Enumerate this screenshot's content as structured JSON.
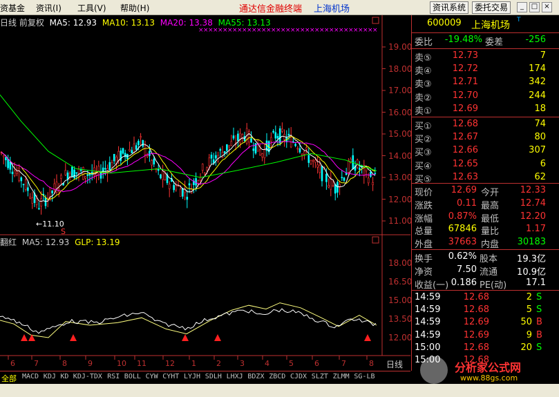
{
  "menu": {
    "item0": "资基金",
    "item1": "资讯(I)",
    "item2": "工具(V)",
    "item3": "帮助(H)",
    "title": "通达信金融终端",
    "subtitle": "上海机场",
    "btn_info": "资讯系统",
    "btn_trade": "委托交易"
  },
  "chart": {
    "main_indicator": "日线 前复权",
    "ma5": "MA5: 12.93",
    "ma10": "MA10: 13.13",
    "ma20": "MA20: 13.38",
    "ma55": "MA55: 13.13",
    "low_mark": "←11.10",
    "sub_indicator": "翻红",
    "sub_ma5": "MA5: 12.93",
    "sub_glp": "GLP: 13.19",
    "period": "日线",
    "x_ticks": [
      "6",
      "7",
      "8",
      "9",
      "10",
      "11",
      "12",
      "1",
      "2",
      "3",
      "4",
      "5",
      "6",
      "7",
      "8"
    ],
    "y_main": [
      "19.00",
      "18.00",
      "17.00",
      "16.00",
      "15.00",
      "14.00",
      "13.00",
      "12.00",
      "11.00"
    ],
    "y_sub": [
      "18.00",
      "16.50",
      "15.00",
      "13.50",
      "12.00"
    ],
    "colors": {
      "ma5": "#ffffff",
      "ma10": "#ffff00",
      "ma20": "#ff00ff",
      "ma55": "#00ff00",
      "up": "#ff3333",
      "down": "#00ffff"
    }
  },
  "panel": {
    "code": "600009",
    "name": "上海机场",
    "weibi_label": "委比",
    "weibi": "-19.48%",
    "weicha_label": "委差",
    "weicha": "-256",
    "sells": [
      {
        "label": "卖⑤",
        "price": "12.73",
        "vol": "7"
      },
      {
        "label": "卖④",
        "price": "12.72",
        "vol": "174"
      },
      {
        "label": "卖③",
        "price": "12.71",
        "vol": "342"
      },
      {
        "label": "卖②",
        "price": "12.70",
        "vol": "244"
      },
      {
        "label": "卖①",
        "price": "12.69",
        "vol": "18"
      }
    ],
    "buys": [
      {
        "label": "买①",
        "price": "12.68",
        "vol": "74"
      },
      {
        "label": "买②",
        "price": "12.67",
        "vol": "80"
      },
      {
        "label": "买③",
        "price": "12.66",
        "vol": "307"
      },
      {
        "label": "买④",
        "price": "12.65",
        "vol": "6"
      },
      {
        "label": "买⑤",
        "price": "12.63",
        "vol": "62"
      }
    ],
    "quote": [
      {
        "l1": "现价",
        "v1": "12.69",
        "l2": "今开",
        "v2": "12.33"
      },
      {
        "l1": "涨跌",
        "v1": "0.11",
        "l2": "最高",
        "v2": "12.74"
      },
      {
        "l1": "涨幅",
        "v1": "0.87%",
        "l2": "最低",
        "v2": "12.20"
      },
      {
        "l1": "总量",
        "v1": "67846",
        "l2": "量比",
        "v2": "1.17"
      },
      {
        "l1": "外盘",
        "v1": "37663",
        "l2": "内盘",
        "v2": "30183"
      }
    ],
    "fin": [
      {
        "l1": "换手",
        "v1": "0.62%",
        "l2": "股本",
        "v2": "19.3亿"
      },
      {
        "l1": "净资",
        "v1": "7.50",
        "l2": "流通",
        "v2": "10.9亿"
      },
      {
        "l1": "收益(一)",
        "v1": "0.186",
        "l2": "PE(动)",
        "v2": "17.1"
      }
    ],
    "ticks": [
      {
        "time": "14:59",
        "price": "12.68",
        "vol": "2",
        "side": "S"
      },
      {
        "time": "14:59",
        "price": "12.68",
        "vol": "5",
        "side": "S"
      },
      {
        "time": "14:59",
        "price": "12.69",
        "vol": "50",
        "side": "B"
      },
      {
        "time": "14:59",
        "price": "12.69",
        "vol": "9",
        "side": "B"
      },
      {
        "time": "15:00",
        "price": "12.68",
        "vol": "20",
        "side": "S"
      },
      {
        "time": "15:00",
        "price": "12.68",
        "vol": "",
        "side": ""
      }
    ]
  },
  "tabs": [
    "全部",
    "MACD",
    "KDJ",
    "KD",
    "KDJ-TDX",
    "RSI",
    "BOLL",
    "CYW",
    "CYHT",
    "LYJH",
    "SDLH",
    "LHXJ",
    "BDZX",
    "ZBCD",
    "CJDX",
    "SLZT",
    "ZLMM",
    "SG-LB"
  ],
  "watermark": {
    "text": "分析家公式网",
    "url": "www.88gs.com"
  }
}
